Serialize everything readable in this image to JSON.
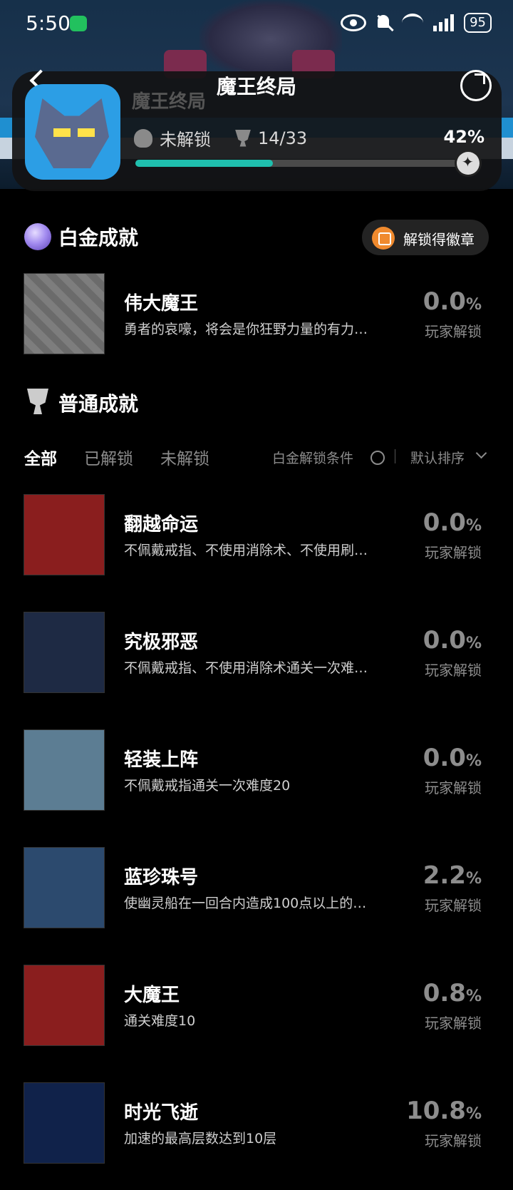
{
  "status": {
    "time": "5:50",
    "battery": "95"
  },
  "header": {
    "title": "魔王终局",
    "game_name": "魔王终局",
    "lock_status": "未解锁",
    "count": "14/33",
    "percent": "42%",
    "progress_fraction": 0.42
  },
  "platinum": {
    "title": "白金成就",
    "badge_label": "解锁得徽章",
    "item": {
      "name": "伟大魔王",
      "desc": "勇者的哀嚎，将会是你狂野力量的有力…",
      "pct": "0.0",
      "unit": "%",
      "label": "玩家解锁",
      "art_bg": "#7a7a7a"
    }
  },
  "normal": {
    "title": "普通成就"
  },
  "tabs": {
    "all": "全部",
    "unlocked": "已解锁",
    "locked": "未解锁",
    "filter": "白金解锁条件",
    "sort": "默认排序"
  },
  "achievements": [
    {
      "name": "翻越命运",
      "desc": "不佩戴戒指、不使用消除术、不使用刷…",
      "pct": "0.0",
      "unit": "%",
      "label": "玩家解锁",
      "art_bg": "#8a1e1e"
    },
    {
      "name": "究极邪恶",
      "desc": "不佩戴戒指、不使用消除术通关一次难…",
      "pct": "0.0",
      "unit": "%",
      "label": "玩家解锁",
      "art_bg": "#1e2a44"
    },
    {
      "name": "轻装上阵",
      "desc": "不佩戴戒指通关一次难度20",
      "pct": "0.0",
      "unit": "%",
      "label": "玩家解锁",
      "art_bg": "#5c7d93"
    },
    {
      "name": "蓝珍珠号",
      "desc": "使幽灵船在一回合内造成100点以上的…",
      "pct": "2.2",
      "unit": "%",
      "label": "玩家解锁",
      "art_bg": "#2c4a6e"
    },
    {
      "name": "大魔王",
      "desc": "通关难度10",
      "pct": "0.8",
      "unit": "%",
      "label": "玩家解锁",
      "art_bg": "#8a1e1e"
    },
    {
      "name": "时光飞逝",
      "desc": "加速的最高层数达到10层",
      "pct": "10.8",
      "unit": "%",
      "label": "玩家解锁",
      "art_bg": "#10224a"
    }
  ]
}
